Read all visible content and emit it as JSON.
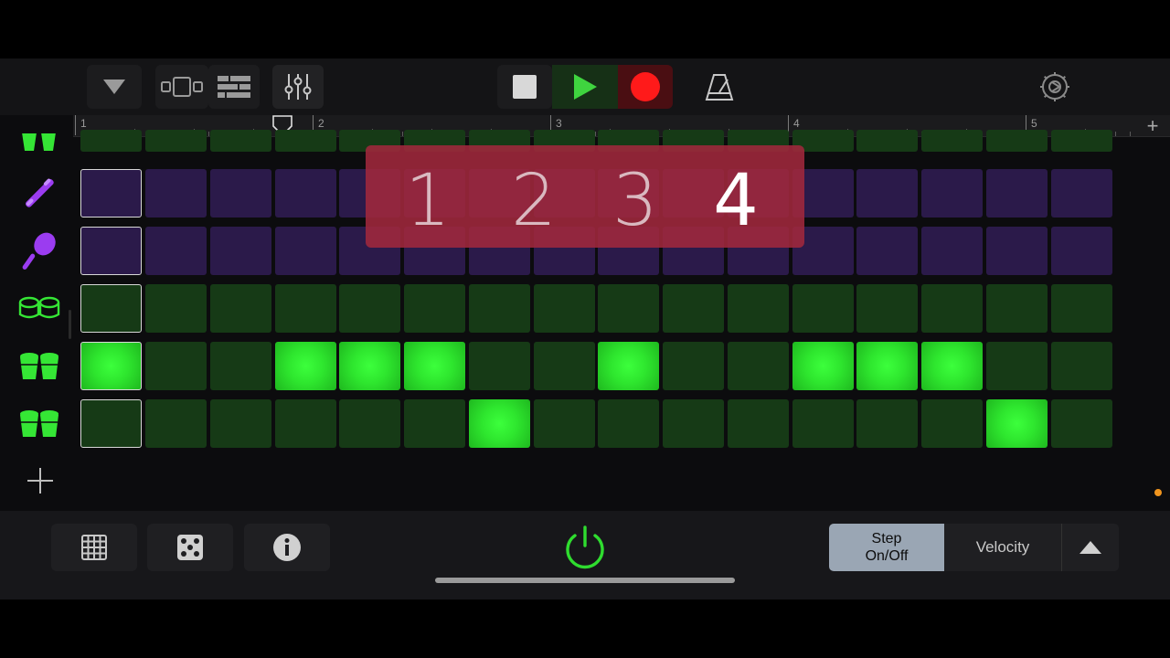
{
  "ruler": {
    "bars": [
      "1",
      "2",
      "3",
      "4",
      "5"
    ],
    "add_label": "+"
  },
  "countin": {
    "numbers": [
      "1",
      "2",
      "3",
      "4"
    ],
    "active_index": 3
  },
  "tracks": [
    {
      "name": "bongo-top-track",
      "icon": "bongo-icon",
      "color": "green"
    },
    {
      "name": "claves-track",
      "icon": "claves-icon",
      "color": "purple"
    },
    {
      "name": "maraca-track",
      "icon": "maraca-icon",
      "color": "purple"
    },
    {
      "name": "conga-low-track",
      "icon": "conga-icon",
      "color": "green"
    },
    {
      "name": "bongo-track",
      "icon": "bongo-icon",
      "color": "green"
    },
    {
      "name": "bongo-high-track",
      "icon": "bongo-icon",
      "color": "green"
    }
  ],
  "steps": [
    [
      0,
      0,
      0,
      0,
      0,
      0,
      0,
      0,
      0,
      0,
      0,
      0,
      0,
      0,
      0,
      0
    ],
    [
      0,
      0,
      0,
      0,
      0,
      0,
      0,
      0,
      0,
      0,
      0,
      0,
      0,
      0,
      0,
      0
    ],
    [
      0,
      0,
      0,
      0,
      0,
      0,
      0,
      0,
      0,
      0,
      0,
      0,
      0,
      0,
      0,
      0
    ],
    [
      0,
      0,
      0,
      0,
      0,
      0,
      0,
      0,
      0,
      0,
      0,
      0,
      0,
      0,
      0,
      0
    ],
    [
      1,
      0,
      0,
      1,
      1,
      1,
      0,
      0,
      1,
      0,
      0,
      1,
      1,
      1,
      0,
      0
    ],
    [
      0,
      0,
      0,
      0,
      0,
      0,
      1,
      0,
      0,
      0,
      0,
      0,
      0,
      0,
      1,
      0
    ]
  ],
  "colors": {
    "green_off": "#163a16",
    "green_on": "#2ee62e",
    "purple_off": "#2b1a4a",
    "icon_green": "#35e635",
    "icon_purple": "#9b3cf0",
    "record": "#ff1a1a",
    "play": "#3fd43f",
    "countin_bg": "#a0283c",
    "accent_orange": "#f0951e"
  },
  "bottom": {
    "step_label_line1": "Step",
    "step_label_line2": "On/Off",
    "velocity_label": "Velocity"
  }
}
